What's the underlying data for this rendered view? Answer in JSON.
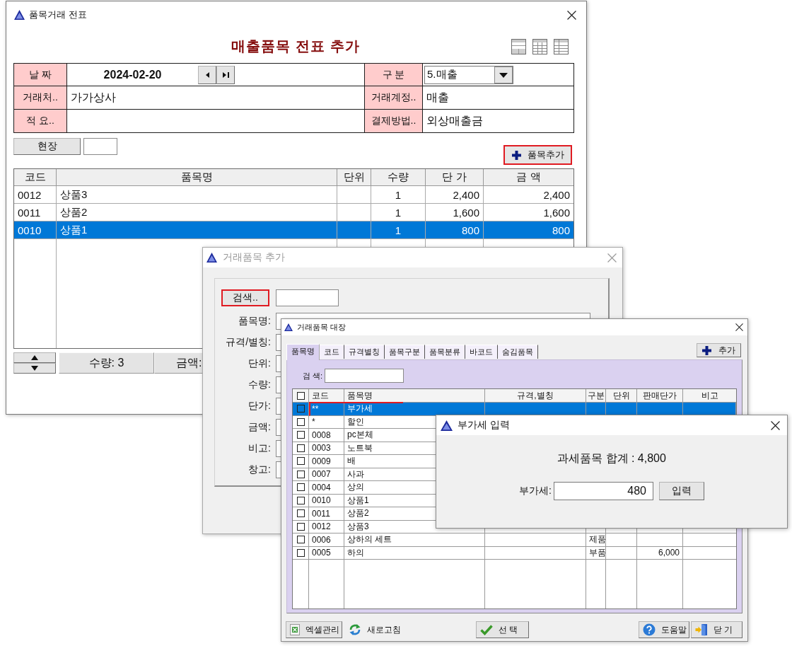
{
  "voucher_window": {
    "title": "품목거래 전표",
    "heading": "매출품목 전표 추가",
    "form": {
      "date_label": "날 짜",
      "date": "2024-02-20",
      "type_label": "구 분",
      "type": "5.매출",
      "customer_label": "거래처..",
      "customer": "가가상사",
      "account_label": "거래계정..",
      "account": "매출",
      "memo_label": "적 요..",
      "payment_label": "결제방법..",
      "payment": "외상매출금"
    },
    "site_button": "현장",
    "add_item_button": {
      "label": "품목추가",
      "highlighted": true
    },
    "table": {
      "columns": [
        "코드",
        "품목명",
        "단위",
        "수량",
        "단 가",
        "금 액"
      ],
      "rows": [
        {
          "code": "0012",
          "name": "상품3",
          "quantity": "1",
          "unit_price": "2,400",
          "amount": "2,400",
          "selected": false
        },
        {
          "code": "0011",
          "name": "상품2",
          "quantity": "1",
          "unit_price": "1,600",
          "amount": "1,600",
          "selected": false
        },
        {
          "code": "0010",
          "name": "상품1",
          "quantity": "1",
          "unit_price": "800",
          "amount": "800",
          "selected": true
        }
      ]
    },
    "status_bar": {
      "quantity": "수량: 3",
      "amount_label": "금액:"
    }
  },
  "item_add_dialog": {
    "title": "거래품목 추가",
    "disabled": true,
    "search_button": {
      "label": "검색..",
      "highlighted": true
    },
    "field_labels": [
      "품목명:",
      "규격/별칭:",
      "단위:",
      "수량:",
      "단가:",
      "금액:",
      "비고:",
      "창고:"
    ]
  },
  "item_list_window": {
    "title": "거래품목 대장",
    "tabs": [
      {
        "label": "품목명",
        "selected": true
      },
      {
        "label": "코드",
        "selected": false
      },
      {
        "label": "규격별칭",
        "selected": false
      },
      {
        "label": "품목구분",
        "selected": false
      },
      {
        "label": "품목분류",
        "selected": false
      },
      {
        "label": "바코드",
        "selected": false
      },
      {
        "label": "숨김품목",
        "selected": false
      }
    ],
    "add_button": "추가",
    "search_label": "검 색:",
    "table": {
      "all_checked": false,
      "columns": [
        "코드",
        "품목명",
        "규격,별칭",
        "구분",
        "단위",
        "판매단가",
        "비고"
      ],
      "rows": [
        {
          "code": "**",
          "name": "부가세",
          "checked": false,
          "selected": true,
          "highlighted": true
        },
        {
          "code": "*",
          "name": "할인",
          "checked": false,
          "selected": false,
          "highlighted": false
        },
        {
          "code": "0008",
          "name": "pc본체",
          "checked": false,
          "selected": false,
          "highlighted": false
        },
        {
          "code": "0003",
          "name": "노트북",
          "checked": false,
          "selected": false,
          "highlighted": false
        },
        {
          "code": "0009",
          "name": "배",
          "checked": false,
          "selected": false,
          "highlighted": false
        },
        {
          "code": "0007",
          "name": "사과",
          "checked": false,
          "selected": false,
          "highlighted": false
        },
        {
          "code": "0004",
          "name": "상의",
          "checked": false,
          "selected": false,
          "highlighted": false
        },
        {
          "code": "0010",
          "name": "상품1",
          "checked": false,
          "selected": false,
          "highlighted": false
        },
        {
          "code": "0011",
          "name": "상품2",
          "checked": false,
          "selected": false,
          "highlighted": false
        },
        {
          "code": "0012",
          "name": "상품3",
          "checked": false,
          "selected": false,
          "highlighted": false
        },
        {
          "code": "0006",
          "name": "상하의 세트",
          "category": "제품",
          "checked": false,
          "selected": false,
          "highlighted": false
        },
        {
          "code": "0005",
          "name": "하의",
          "category": "부품",
          "price": "6,000",
          "checked": false,
          "selected": false,
          "highlighted": false
        }
      ]
    },
    "buttons": [
      {
        "kind": "excel",
        "label": "엑셀관리"
      },
      {
        "kind": "refresh",
        "label": "새로고침"
      },
      {
        "kind": "select",
        "label": "선 택"
      },
      {
        "kind": "help",
        "label": "도움말"
      },
      {
        "kind": "close",
        "label": "닫 기"
      }
    ]
  },
  "vat_dialog": {
    "title": "부가세 입력",
    "total": "과세품목 합계 : 4,800",
    "vat_label": "부가세:",
    "vat_value": "480",
    "submit_button": "입력"
  }
}
